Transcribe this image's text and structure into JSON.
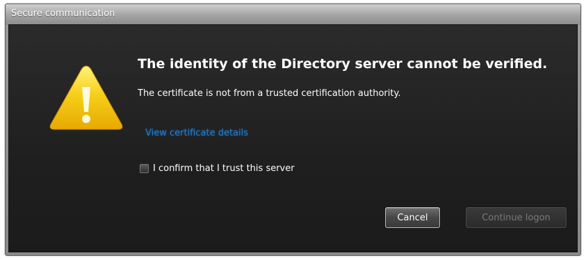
{
  "window": {
    "title": "Secure communication"
  },
  "dialog": {
    "icon": "warning-triangle-icon",
    "heading": "The identity of the Directory server cannot be verified.",
    "message": "The certificate is not from a trusted certification authority.",
    "link_label": "View certificate details",
    "checkbox": {
      "label": "I confirm that I trust this server",
      "checked": false
    },
    "buttons": {
      "cancel": "Cancel",
      "continue": "Continue logon",
      "continue_enabled": false
    }
  },
  "colors": {
    "background": "#1f1f1f",
    "link": "#1d7fd0",
    "warning_yellow": "#f5c400",
    "disabled_text": "#7a7a7a"
  }
}
